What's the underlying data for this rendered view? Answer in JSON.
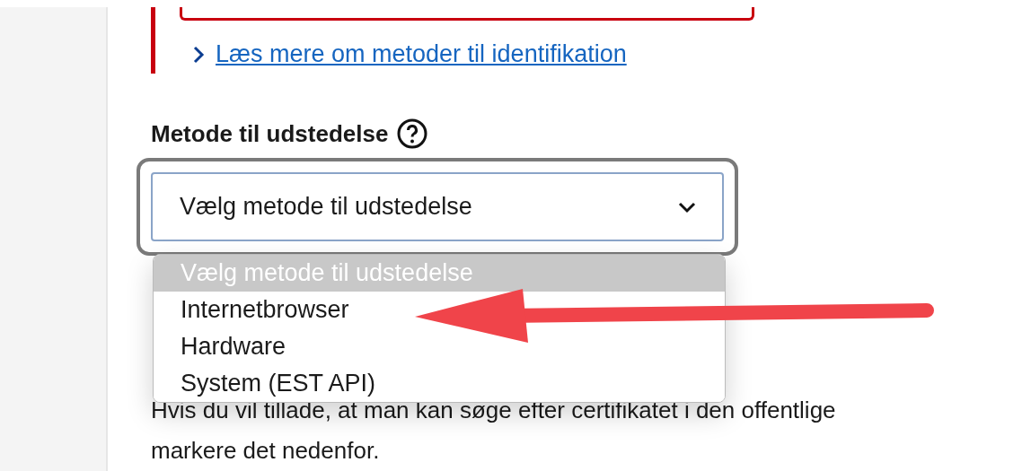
{
  "link": {
    "text": "Læs mere om metoder til identifikation"
  },
  "field": {
    "label": "Metode til udstedelse",
    "value": "Vælg metode til udstedelse",
    "expanded": true,
    "options": [
      {
        "label": "Vælg metode til udstedelse",
        "selected": true
      },
      {
        "label": "Internetbrowser",
        "selected": false
      },
      {
        "label": "Hardware",
        "selected": false
      },
      {
        "label": "System (EST API)",
        "selected": false
      }
    ]
  },
  "paragraph": [
    "Hvis du vil tillade, at man kan søge efter certifikatet i den offentlige",
    "markere det nedenfor."
  ]
}
